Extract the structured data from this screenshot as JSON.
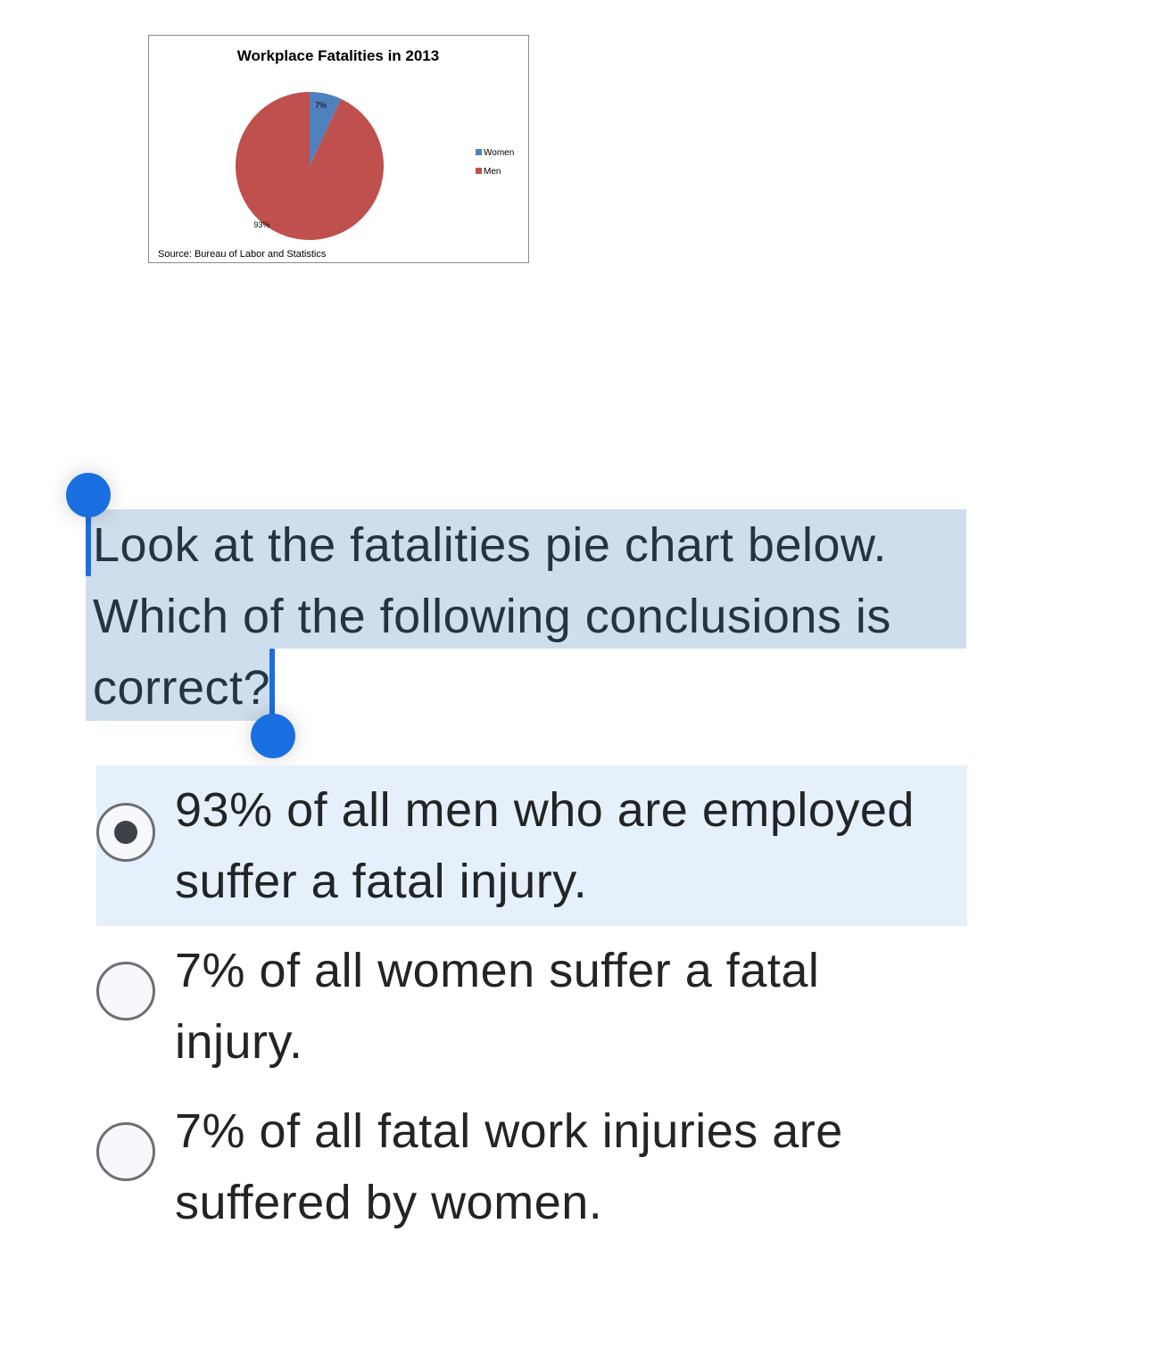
{
  "chart_data": {
    "type": "pie",
    "title": "Workplace Fatalities in 2013",
    "categories": [
      "Women",
      "Men"
    ],
    "values": [
      7,
      93
    ],
    "data_labels": [
      "7%",
      "93%"
    ],
    "colors": [
      "#4f81bd",
      "#c0504d"
    ],
    "legend": [
      "Women",
      "Men"
    ],
    "legend_position": "right",
    "source": "Source: Bureau of Labor and Statistics"
  },
  "question": {
    "lines": [
      "Look at the fatalities pie chart below.",
      "Which of the following conclusions is",
      "correct?"
    ]
  },
  "options": [
    {
      "lines": [
        "93% of all men who are employed",
        "suffer a fatal injury."
      ],
      "selected": true
    },
    {
      "lines": [
        "7% of all women suffer a fatal",
        "injury."
      ],
      "selected": false
    },
    {
      "lines": [
        "7% of all fatal work injuries are",
        "suffered by women."
      ],
      "selected": false
    }
  ],
  "colors": {
    "selection": "#cfdeed",
    "selected_option_bg": "#e6f0fb",
    "handle": "#1a6fe0",
    "question_text": "#243443"
  }
}
